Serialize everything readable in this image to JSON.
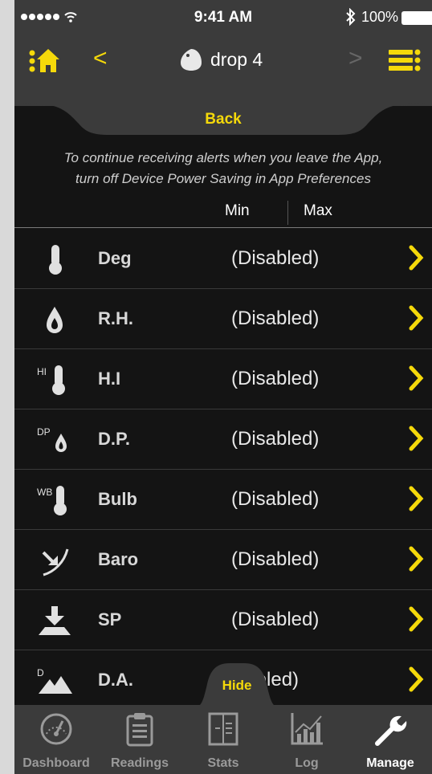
{
  "status": {
    "time": "9:41 AM",
    "battery": "100%"
  },
  "nav": {
    "device_name": "drop 4"
  },
  "back_label": "Back",
  "notice": [
    "To continue receiving alerts when you leave the App,",
    "turn off Device Power Saving in App Preferences"
  ],
  "columns": {
    "min": "Min",
    "max": "Max"
  },
  "rows": [
    {
      "name": "Deg",
      "value": "(Disabled)",
      "icon": "thermometer-icon"
    },
    {
      "name": "R.H.",
      "value": "(Disabled)",
      "icon": "droplet-icon"
    },
    {
      "name": "H.I",
      "value": "(Disabled)",
      "icon": "heat-index-icon"
    },
    {
      "name": "D.P.",
      "value": "(Disabled)",
      "icon": "dew-point-icon"
    },
    {
      "name": "Bulb",
      "value": "(Disabled)",
      "icon": "wet-bulb-icon"
    },
    {
      "name": "Baro",
      "value": "(Disabled)",
      "icon": "barometer-icon"
    },
    {
      "name": "SP",
      "value": "(Disabled)",
      "icon": "station-pressure-icon"
    },
    {
      "name": "D.A.",
      "value": "isabled)",
      "icon": "density-altitude-icon"
    }
  ],
  "hide_label": "Hide",
  "tabs": [
    {
      "label": "Dashboard",
      "icon": "gauge-icon"
    },
    {
      "label": "Readings",
      "icon": "clipboard-icon"
    },
    {
      "label": "Stats",
      "icon": "stats-icon"
    },
    {
      "label": "Log",
      "icon": "graph-icon"
    },
    {
      "label": "Manage",
      "icon": "wrench-icon",
      "active": true
    }
  ],
  "colors": {
    "accent": "#f5d90a",
    "background": "#141414",
    "bar": "#3b3b3b"
  }
}
